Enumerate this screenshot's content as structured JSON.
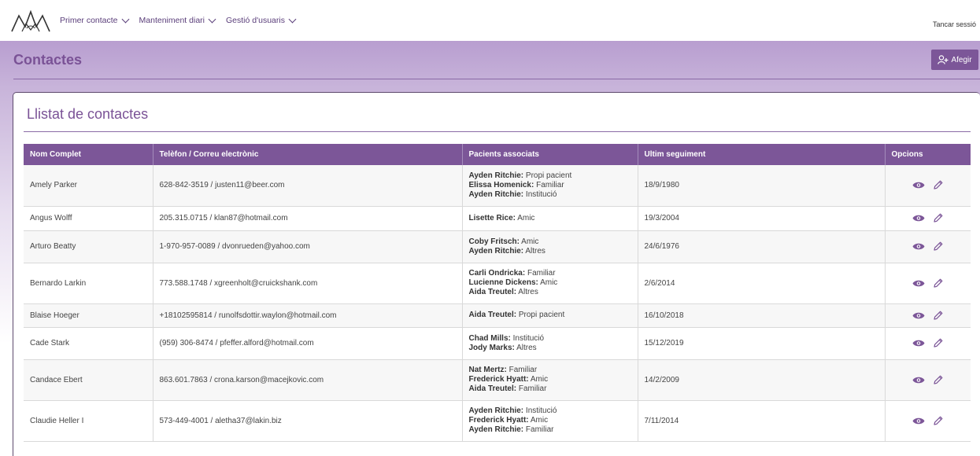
{
  "nav": {
    "items": [
      {
        "label": "Primer contacte"
      },
      {
        "label": "Manteniment diari"
      },
      {
        "label": "Gestió d'usuaris"
      }
    ],
    "logout": "Tancar sessió"
  },
  "header": {
    "title": "Contactes",
    "add_label": "Afegir"
  },
  "card": {
    "title": "Llistat de contactes"
  },
  "table": {
    "columns": [
      "Nom Complet",
      "Telèfon / Correu electrònic",
      "Pacients associats",
      "Ultim seguiment",
      "Opcions"
    ],
    "rows": [
      {
        "name": "Amely Parker",
        "contact": "628-842-3519 / justen11@beer.com",
        "patients": [
          {
            "name": "Ayden Ritchie:",
            "rel": " Propi pacient"
          },
          {
            "name": "Elissa Homenick:",
            "rel": " Familiar"
          },
          {
            "name": "Ayden Ritchie:",
            "rel": " Institució"
          }
        ],
        "date": "18/9/1980"
      },
      {
        "name": "Angus Wolff",
        "contact": "205.315.0715 / klan87@hotmail.com",
        "patients": [
          {
            "name": "Lisette Rice:",
            "rel": " Amic"
          }
        ],
        "date": "19/3/2004"
      },
      {
        "name": "Arturo Beatty",
        "contact": "1-970-957-0089 / dvonrueden@yahoo.com",
        "patients": [
          {
            "name": "Coby Fritsch:",
            "rel": " Amic"
          },
          {
            "name": "Ayden Ritchie:",
            "rel": " Altres"
          }
        ],
        "date": "24/6/1976"
      },
      {
        "name": "Bernardo Larkin",
        "contact": "773.588.1748 / xgreenholt@cruickshank.com",
        "patients": [
          {
            "name": "Carli Ondricka:",
            "rel": " Familiar"
          },
          {
            "name": "Lucienne Dickens:",
            "rel": " Amic"
          },
          {
            "name": "Aida Treutel:",
            "rel": " Altres"
          }
        ],
        "date": "2/6/2014"
      },
      {
        "name": "Blaise Hoeger",
        "contact": "+18102595814 / runolfsdottir.waylon@hotmail.com",
        "patients": [
          {
            "name": "Aida Treutel:",
            "rel": " Propi pacient"
          }
        ],
        "date": "16/10/2018"
      },
      {
        "name": "Cade Stark",
        "contact": "(959) 306-8474 / pfeffer.alford@hotmail.com",
        "patients": [
          {
            "name": "Chad Mills:",
            "rel": " Institució"
          },
          {
            "name": "Jody Marks:",
            "rel": " Altres"
          }
        ],
        "date": "15/12/2019"
      },
      {
        "name": "Candace Ebert",
        "contact": "863.601.7863 / crona.karson@macejkovic.com",
        "patients": [
          {
            "name": "Nat Mertz:",
            "rel": " Familiar"
          },
          {
            "name": "Frederick Hyatt:",
            "rel": " Amic"
          },
          {
            "name": "Aida Treutel:",
            "rel": " Familiar"
          }
        ],
        "date": "14/2/2009"
      },
      {
        "name": "Claudie Heller I",
        "contact": "573-449-4001 / aletha37@lakin.biz",
        "patients": [
          {
            "name": "Ayden Ritchie:",
            "rel": " Institució"
          },
          {
            "name": "Frederick Hyatt:",
            "rel": " Amic"
          },
          {
            "name": "Ayden Ritchie:",
            "rel": " Familiar"
          }
        ],
        "date": "7/11/2014"
      }
    ]
  },
  "icons": {
    "view": "eye-icon",
    "edit": "pencil-icon",
    "add": "add-user-icon",
    "logo": "mountains-logo"
  },
  "colors": {
    "accent": "#7c5698",
    "title": "#7a5296"
  }
}
